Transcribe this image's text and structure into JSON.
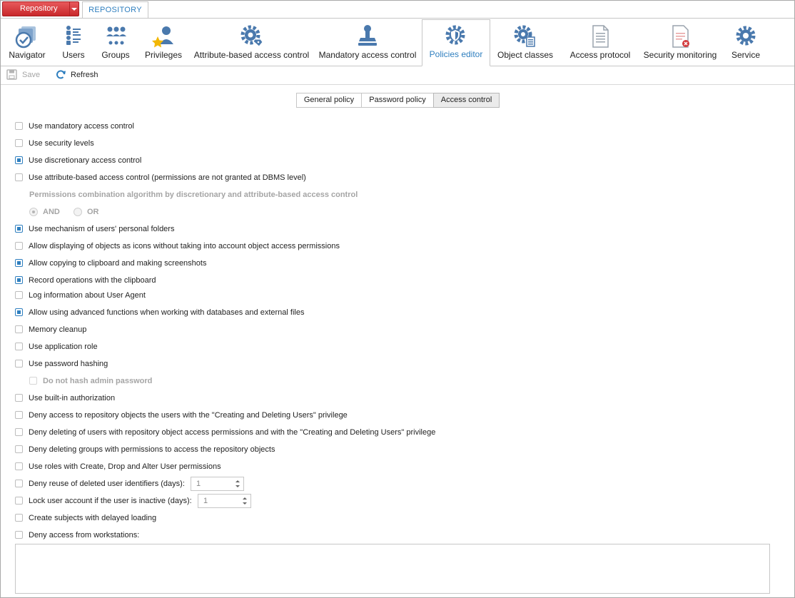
{
  "top": {
    "repository_button": "Repository",
    "repository_tab": "REPOSITORY"
  },
  "ribbon": {
    "items": [
      {
        "label": "Navigator",
        "icon": "navigator-icon"
      },
      {
        "label": "Users",
        "icon": "users-icon"
      },
      {
        "label": "Groups",
        "icon": "groups-icon"
      },
      {
        "label": "Privileges",
        "icon": "privileges-icon"
      },
      {
        "label": "Attribute-based access control",
        "icon": "attribute-gear-icon"
      },
      {
        "label": "Mandatory access control",
        "icon": "stamp-icon"
      },
      {
        "label": "Policies editor",
        "icon": "shield-gear-icon"
      },
      {
        "label": "Object classes",
        "icon": "object-classes-icon"
      },
      {
        "label": "Access protocol",
        "icon": "document-icon"
      },
      {
        "label": "Security monitoring",
        "icon": "security-monitoring-icon"
      },
      {
        "label": "Service",
        "icon": "gear-icon"
      }
    ],
    "active": "Policies editor"
  },
  "toolbar": {
    "save_label": "Save",
    "refresh_label": "Refresh"
  },
  "tabs": {
    "general": "General policy",
    "password": "Password policy",
    "access": "Access control",
    "active": "Access control"
  },
  "options": {
    "mandatory": {
      "label": "Use mandatory access control",
      "checked": false
    },
    "security_levels": {
      "label": "Use security levels",
      "checked": false
    },
    "discretionary": {
      "label": "Use discretionary access control",
      "checked": true
    },
    "attribute_based": {
      "label": "Use attribute-based access control (permissions are not granted at DBMS level)",
      "checked": false
    },
    "combination_title": "Permissions combination algorithm by discretionary and attribute-based access control",
    "combination_and": "AND",
    "combination_or": "OR",
    "combination_selected": "AND",
    "personal_folders": {
      "label": "Use mechanism of users' personal folders",
      "checked": true
    },
    "icons_display": {
      "label": "Allow displaying of objects as icons without taking into account object access permissions",
      "checked": false
    },
    "clipboard_copy": {
      "label": "Allow copying to clipboard and making screenshots",
      "checked": true
    },
    "clipboard_record": {
      "label": "Record operations with the clipboard",
      "checked": true
    },
    "user_agent": {
      "label": "Log information about User Agent",
      "checked": false
    },
    "advanced_functions": {
      "label": "Allow using advanced functions when working with databases and external files",
      "checked": true
    },
    "memory_cleanup": {
      "label": "Memory cleanup",
      "checked": false
    },
    "application_role": {
      "label": "Use application role",
      "checked": false
    },
    "password_hashing": {
      "label": "Use password hashing",
      "checked": false
    },
    "no_hash_admin": {
      "label": "Do not hash admin password",
      "checked": false
    },
    "builtin_auth": {
      "label": "Use built-in authorization",
      "checked": false
    },
    "deny_repo_access": {
      "label": "Deny access to repository objects the users with the \"Creating and Deleting Users\" privilege",
      "checked": false
    },
    "deny_delete_users": {
      "label": "Deny deleting of users with repository object access permissions and with the \"Creating and Deleting Users\" privilege",
      "checked": false
    },
    "deny_delete_groups": {
      "label": "Deny deleting groups with permissions to access the repository objects",
      "checked": false
    },
    "roles_create_drop": {
      "label": "Use roles with Create, Drop and Alter User permissions",
      "checked": false
    },
    "deny_reuse_ids": {
      "label": "Deny reuse of deleted user identifiers (days):",
      "checked": false,
      "value": "1"
    },
    "lock_inactive": {
      "label": "Lock user account if the user is inactive (days):",
      "checked": false,
      "value": "1"
    },
    "delayed_loading": {
      "label": "Create subjects with delayed loading",
      "checked": false
    },
    "deny_workstations": {
      "label": "Deny access from workstations:",
      "checked": false,
      "text": ""
    }
  },
  "colors": {
    "accent": "#2f7fbf",
    "repository_red": "#d33b3e",
    "icon_blue": "#4a79ad"
  }
}
